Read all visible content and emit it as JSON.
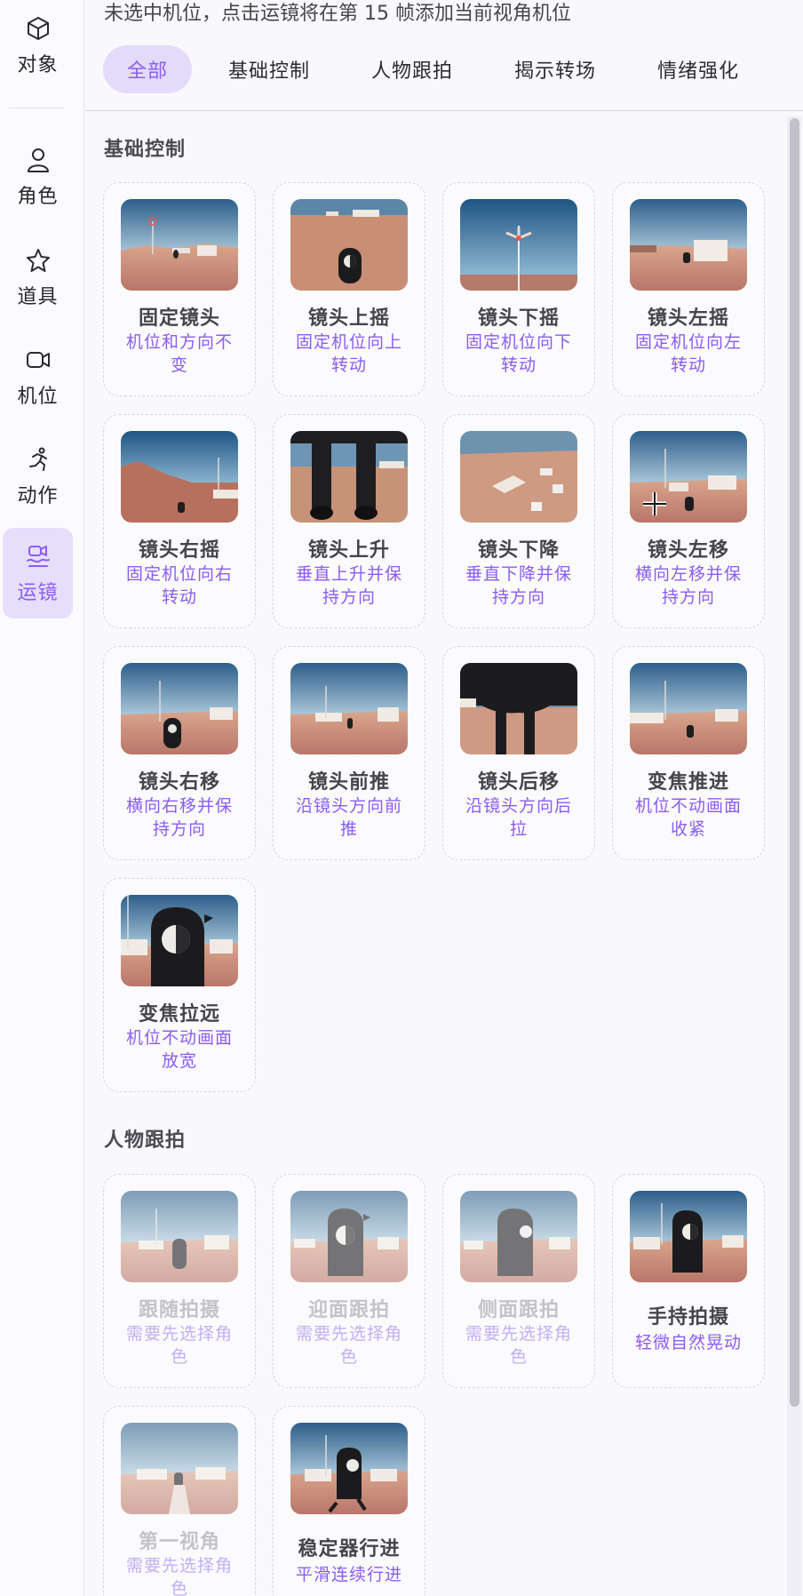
{
  "sidebar": {
    "items": [
      {
        "label": "对象",
        "icon": "cube-icon"
      },
      {
        "label": "角色",
        "icon": "user-icon"
      },
      {
        "label": "道具",
        "icon": "star-icon"
      },
      {
        "label": "机位",
        "icon": "video-camera-icon"
      },
      {
        "label": "动作",
        "icon": "running-person-icon"
      },
      {
        "label": "运镜",
        "icon": "camera-movement-icon"
      }
    ],
    "active": "运镜"
  },
  "notice": "未选中机位，点击运镜将在第 15 帧添加当前视角机位",
  "tabs": [
    "全部",
    "基础控制",
    "人物跟拍",
    "揭示转场",
    "情绪强化"
  ],
  "active_tab": "全部",
  "sections": [
    {
      "title": "基础控制",
      "cards": [
        {
          "name": "固定镜头",
          "desc": "机位和方向不变"
        },
        {
          "name": "镜头上摇",
          "desc": "固定机位向上转动"
        },
        {
          "name": "镜头下摇",
          "desc": "固定机位向下转动"
        },
        {
          "name": "镜头左摇",
          "desc": "固定机位向左转动"
        },
        {
          "name": "镜头右摇",
          "desc": "固定机位向右转动"
        },
        {
          "name": "镜头上升",
          "desc": "垂直上升并保持方向"
        },
        {
          "name": "镜头下降",
          "desc": "垂直下降并保持方向"
        },
        {
          "name": "镜头左移",
          "desc": "横向左移并保持方向"
        },
        {
          "name": "镜头右移",
          "desc": "横向右移并保持方向"
        },
        {
          "name": "镜头前推",
          "desc": "沿镜头方向前推"
        },
        {
          "name": "镜头后移",
          "desc": "沿镜头方向后拉"
        },
        {
          "name": "变焦推进",
          "desc": "机位不动画面收紧"
        },
        {
          "name": "变焦拉远",
          "desc": "机位不动画面放宽"
        }
      ]
    },
    {
      "title": "人物跟拍",
      "cards": [
        {
          "name": "跟随拍摄",
          "desc": "需要先选择角色",
          "disabled": true
        },
        {
          "name": "迎面跟拍",
          "desc": "需要先选择角色",
          "disabled": true
        },
        {
          "name": "侧面跟拍",
          "desc": "需要先选择角色",
          "disabled": true
        },
        {
          "name": "手持拍摄",
          "desc": "轻微自然晃动",
          "disabled": false
        },
        {
          "name": "第一视角",
          "desc": "需要先选择角色",
          "disabled": true
        },
        {
          "name": "稳定器行进",
          "desc": "平滑连续行进",
          "disabled": false
        }
      ]
    }
  ],
  "colors": {
    "accent": "#8b5cf6",
    "active_bg": "#e4dbfb",
    "sky": "#3f6f9a",
    "ground": "#c8927a"
  }
}
